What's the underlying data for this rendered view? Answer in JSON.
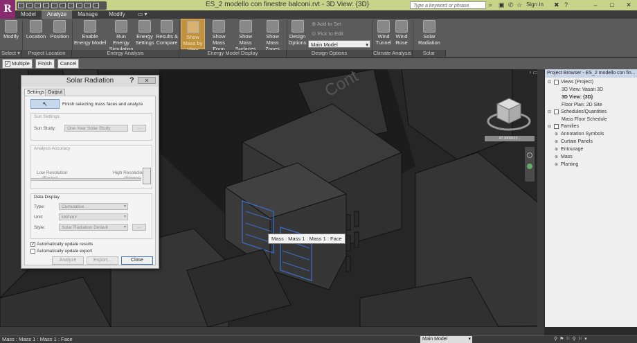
{
  "app": {
    "logo": "R",
    "title": "ES_2 modello con finestre balconi.rvt - 3D View: {3D}",
    "search_placeholder": "Type a keyword or phrase",
    "signin": "Sign In"
  },
  "tabs": [
    "Model",
    "Analyze",
    "Manage",
    "Modify"
  ],
  "active_tab": "Analyze",
  "ribbon": {
    "buttons": [
      {
        "label": "Modify",
        "icon": "cursor-icon"
      },
      {
        "label": "Location",
        "icon": "globe-icon"
      },
      {
        "label": "Position",
        "icon": "position-icon"
      },
      {
        "label": "Enable Energy Model",
        "icon": "energy-icon"
      },
      {
        "label": "Run Energy Simulation",
        "icon": "simulation-icon"
      },
      {
        "label": "Energy Settings",
        "icon": "settings-icon"
      },
      {
        "label": "Results & Compare",
        "icon": "compare-icon"
      },
      {
        "label": "Show Mass by View",
        "icon": "mass-view-icon"
      },
      {
        "label": "Show Mass Form",
        "icon": "mass-form-icon"
      },
      {
        "label": "Show Mass Surfaces",
        "icon": "mass-surfaces-icon"
      },
      {
        "label": "Show Mass Zones",
        "icon": "mass-zones-icon"
      },
      {
        "label": "Design Options",
        "icon": "design-options-icon"
      },
      {
        "label": "Wind Tunnel",
        "icon": "wind-tunnel-icon"
      },
      {
        "label": "Wind Rose",
        "icon": "wind-rose-icon"
      },
      {
        "label": "Solar Radiation",
        "icon": "solar-icon"
      }
    ],
    "add_to_set": "Add to Set",
    "pick_to_edit": "Pick to Edit",
    "main_model": "Main Model",
    "panels": [
      "Select",
      "Project Location",
      "Energy Analysis",
      "Energy Model Display",
      "Design Options",
      "Climate Analysis",
      "Solar Analysis"
    ]
  },
  "options_bar": {
    "multiple": "Multiple",
    "finish": "Finish",
    "cancel": "Cancel"
  },
  "viewport": {
    "cube_label": "47.3808632...",
    "tooltip": "Mass : Mass 1 : Mass 1 : Face",
    "street": "Cont"
  },
  "dialog": {
    "title": "Solar Radiation",
    "help": "?",
    "close": "✕",
    "tabs": [
      "Settings",
      "Output"
    ],
    "finish_text": "Finish selecting mass faces and analyze",
    "sun_settings": "Sun Settings",
    "sun_study_label": "Sun Study:",
    "sun_study_value": "One Year Solar Study",
    "ellipsis": "...",
    "analysis_accuracy": "Analysis Accuracy",
    "low_res": "Low Resolution",
    "faster": "(Faster)",
    "high_res": "High Resolution",
    "slower": "(Slower)",
    "data_display": "Data Display",
    "type_label": "Type:",
    "type_value": "Cumulative",
    "unit_label": "Unit:",
    "unit_value": "kWh/m²",
    "style_label": "Style:",
    "style_value": "Solar Radiation Default",
    "auto_results": "Automatically update results",
    "auto_export": "Automatically update export",
    "analyze": "Analyze",
    "export": "Export...",
    "close_btn": "Close"
  },
  "project_browser": {
    "title": "Project Browser - ES_2 modello con fin...",
    "items": [
      {
        "label": "Views (Project)",
        "level": 0
      },
      {
        "label": "3D View: Vasari 3D",
        "level": 1
      },
      {
        "label": "3D View: {3D}",
        "level": 1,
        "bold": true
      },
      {
        "label": "Floor Plan: 2D Site",
        "level": 1
      },
      {
        "label": "Schedules/Quantities",
        "level": 0
      },
      {
        "label": "Mass Floor Schedule",
        "level": 1
      },
      {
        "label": "Families",
        "level": 0
      },
      {
        "label": "Annotation Symbols",
        "level": 1
      },
      {
        "label": "Curtain Panels",
        "level": 1
      },
      {
        "label": "Entourage",
        "level": 1
      },
      {
        "label": "Mass",
        "level": 1
      },
      {
        "label": "Planting",
        "level": 1
      }
    ]
  },
  "status": {
    "text": "Mass : Mass 1 : Mass 1 : Face",
    "model": "Main Model"
  }
}
